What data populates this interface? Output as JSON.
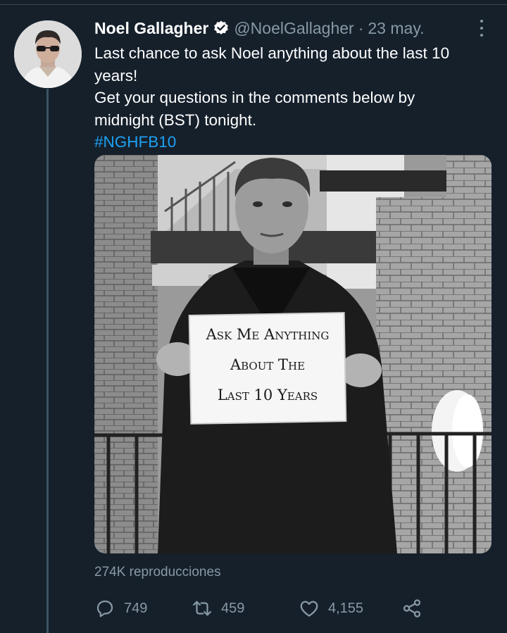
{
  "tweet": {
    "author_name": "Noel Gallagher",
    "handle": "@NoelGallagher",
    "separator": "·",
    "timestamp": "23 may.",
    "verified": true,
    "text_lines": [
      "Last chance to ask Noel anything about the last 10",
      "years!",
      "Get your questions in the comments below by",
      "midnight (BST) tonight."
    ],
    "hashtag": "#NGHFB10",
    "media": {
      "sign_lines": [
        "Ask Me Anything",
        "About The",
        "Last 10 Years"
      ]
    },
    "views": "274K reproducciones",
    "actions": {
      "reply_count": "749",
      "retweet_count": "459",
      "like_count": "4,155"
    }
  },
  "colors": {
    "background": "#15202b",
    "secondary_text": "#8899a6",
    "link": "#1da1f2",
    "thread_line": "#3d5466"
  },
  "icons": [
    "verified-badge-icon",
    "more-options-icon",
    "reply-icon",
    "retweet-icon",
    "like-icon",
    "share-icon"
  ]
}
